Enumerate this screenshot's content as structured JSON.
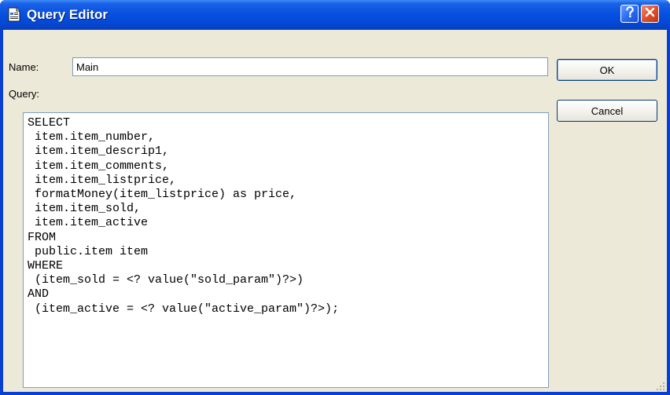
{
  "window": {
    "title": "Query Editor",
    "title_icon": "document-icon",
    "help_button": "?",
    "close_button": "close"
  },
  "form": {
    "name_label": "Name:",
    "name_value": "Main",
    "query_label": "Query:",
    "query_text": "SELECT\n item.item_number,\n item.item_descrip1,\n item.item_comments,\n item.item_listprice,\n formatMoney(item_listprice) as price,\n item.item_sold,\n item.item_active\nFROM\n public.item item\nWHERE\n (item_sold = <? value(\"sold_param\")?>)\nAND\n (item_active = <? value(\"active_param\")?>);"
  },
  "buttons": {
    "ok_label": "OK",
    "cancel_label": "Cancel"
  },
  "colors": {
    "titlebar": "#0851e0",
    "dialog_background": "#ece9d8",
    "close_button": "#e0502b",
    "input_border": "#7f9db9"
  }
}
